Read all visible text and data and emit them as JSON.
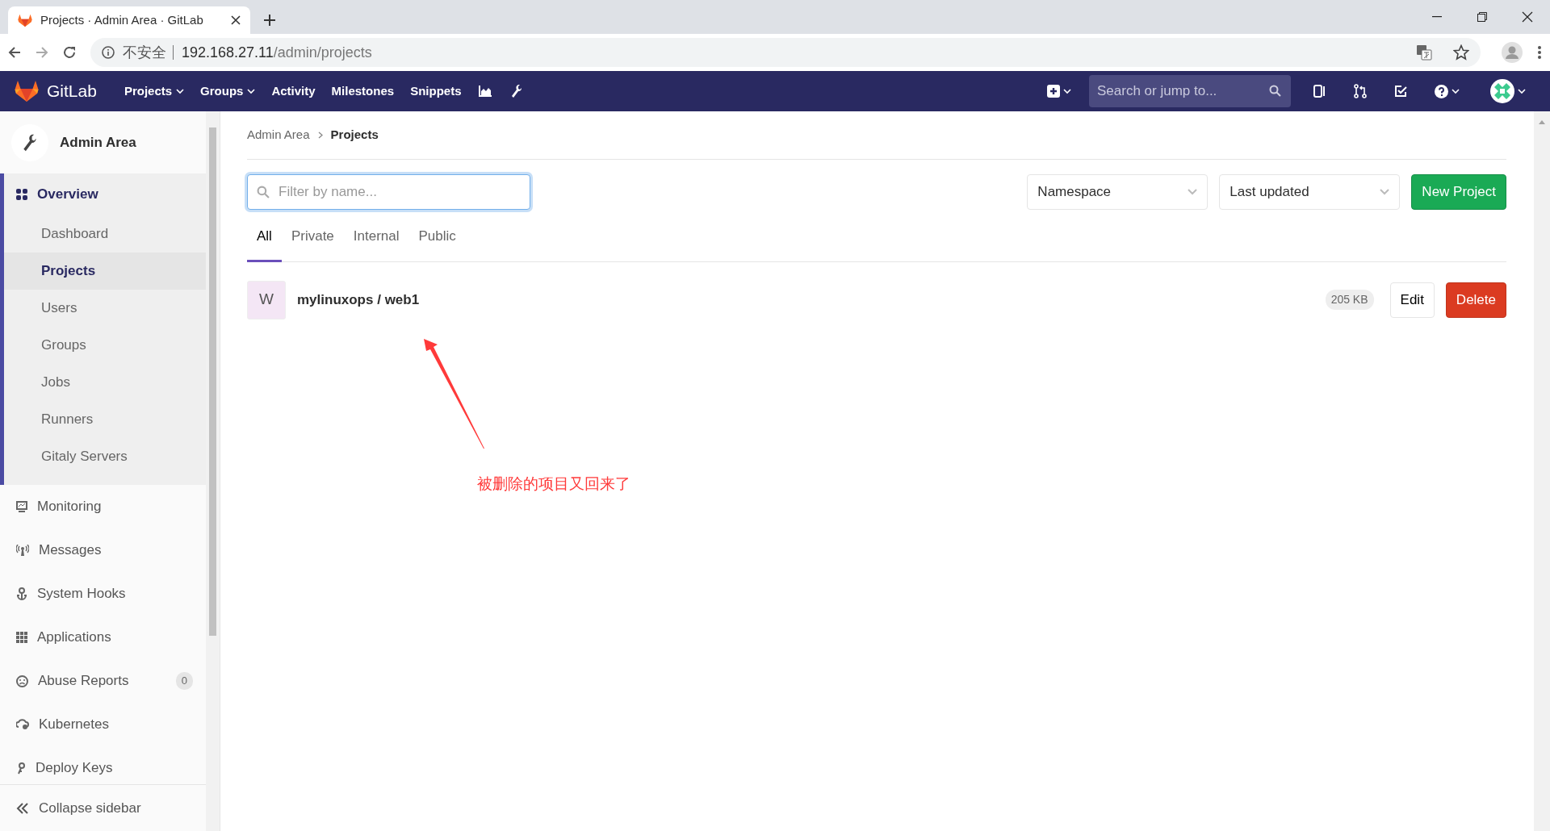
{
  "browser": {
    "tab_title": "Projects · Admin Area · GitLab",
    "security": "不安全",
    "url_host": "192.168.27.11",
    "url_path": "/admin/projects"
  },
  "navbar": {
    "brand": "GitLab",
    "links": [
      {
        "label": "Projects",
        "dropdown": true
      },
      {
        "label": "Groups",
        "dropdown": true
      },
      {
        "label": "Activity",
        "dropdown": false
      },
      {
        "label": "Milestones",
        "dropdown": false
      },
      {
        "label": "Snippets",
        "dropdown": false
      }
    ],
    "search": {
      "placeholder": "Search or jump to..."
    }
  },
  "sidebar": {
    "title": "Admin Area",
    "sections": [
      {
        "label": "Overview",
        "expanded": true,
        "selected": true,
        "children": [
          {
            "label": "Dashboard",
            "selected": false
          },
          {
            "label": "Projects",
            "selected": true
          },
          {
            "label": "Users",
            "selected": false
          },
          {
            "label": "Groups",
            "selected": false
          },
          {
            "label": "Jobs",
            "selected": false
          },
          {
            "label": "Runners",
            "selected": false
          },
          {
            "label": "Gitaly Servers",
            "selected": false
          }
        ]
      },
      {
        "label": "Monitoring",
        "expanded": false,
        "selected": false
      },
      {
        "label": "Messages",
        "expanded": false,
        "selected": false
      },
      {
        "label": "System Hooks",
        "expanded": false,
        "selected": false
      },
      {
        "label": "Applications",
        "expanded": false,
        "selected": false
      },
      {
        "label": "Abuse Reports",
        "expanded": false,
        "selected": false,
        "count": "0"
      },
      {
        "label": "Kubernetes",
        "expanded": false,
        "selected": false
      },
      {
        "label": "Deploy Keys",
        "expanded": false,
        "selected": false
      }
    ],
    "collapse": "Collapse sidebar"
  },
  "breadcrumb": [
    {
      "label": "Admin Area",
      "current": false
    },
    {
      "label": "Projects",
      "current": true
    }
  ],
  "filter": {
    "placeholder": "Filter by name..."
  },
  "namespace_select": "Namespace",
  "sort_select": "Last updated",
  "new_button": "New Project",
  "tabs": [
    {
      "label": "All",
      "selected": true
    },
    {
      "label": "Private",
      "selected": false
    },
    {
      "label": "Internal",
      "selected": false
    },
    {
      "label": "Public",
      "selected": false
    }
  ],
  "projects": [
    {
      "avatar": "W",
      "name": "mylinuxops / web1",
      "size": "205 KB",
      "edit": "Edit",
      "delete": "Delete"
    }
  ],
  "annotation": "被删除的项目又回来了"
}
